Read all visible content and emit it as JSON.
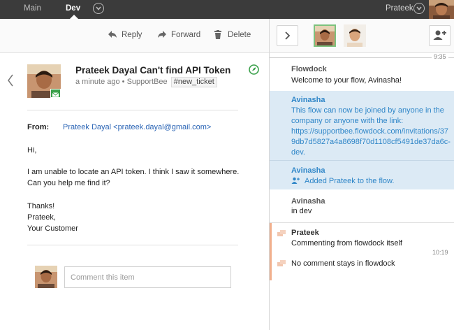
{
  "topbar": {
    "tabs": [
      {
        "label": "Main"
      },
      {
        "label": "Dev"
      }
    ],
    "user_name": "Prateek"
  },
  "toolbar": {
    "reply_label": "Reply",
    "forward_label": "Forward",
    "delete_label": "Delete"
  },
  "ticket": {
    "title": "Prateek Dayal Can't find API Token",
    "meta": "a minute ago • SupportBee",
    "tag": "#new_ticket",
    "from_label": "From:",
    "from_value": "Prateek Dayal <prateek.dayal@gmail.com>",
    "body": [
      "Hi,",
      "I am unable to locate an API token. I think I saw it somewhere.",
      "Can you help me find it?",
      "Thanks!",
      "Prateek,",
      "Your Customer"
    ],
    "comment_placeholder": "Comment this item"
  },
  "flow": {
    "divider_time": "9:35",
    "messages": [
      {
        "author": "Flowdock",
        "lines": [
          "Welcome to your flow, Avinasha!"
        ]
      },
      {
        "author": "Avinasha",
        "lines": [
          "This flow can now be joined by anyone in the",
          "company or anyone with the link:",
          "https://supportbee.flowdock.com/invitations/37",
          "9db7d5827a4a8698f70d1108cf5491de37da6c-",
          "dev."
        ]
      },
      {
        "author": "Avinasha",
        "lines": [
          "Added Prateek to the flow."
        ]
      },
      {
        "author": "Avinasha",
        "lines": [
          "in dev"
        ]
      },
      {
        "author": "Prateek",
        "lines": [
          "Commenting from flowdock itself"
        ]
      },
      {
        "author": "",
        "lines": [
          "No comment stays in flowdock"
        ]
      }
    ],
    "comment_time": "10:19"
  },
  "colors": {
    "topbar": "#3b3b3b",
    "link": "#2a64b5",
    "highlight": "#dceaf5",
    "accent_green": "#3aa04a",
    "thread_border": "#f1b08d"
  }
}
